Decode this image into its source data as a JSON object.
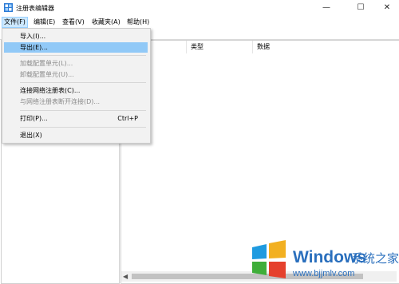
{
  "window": {
    "title": "注册表编辑器"
  },
  "menubar": {
    "items": [
      "文件(F)",
      "编辑(E)",
      "查看(V)",
      "收藏夹(A)",
      "帮助(H)"
    ]
  },
  "file_menu": {
    "items": [
      {
        "label": "导入(I)...",
        "disabled": false
      },
      {
        "label": "导出(E)...",
        "disabled": false,
        "highlighted": true
      },
      {
        "label": "加载配置单元(L)...",
        "disabled": true
      },
      {
        "label": "卸载配置单元(U)...",
        "disabled": true
      },
      {
        "label": "连接网络注册表(C)...",
        "disabled": false
      },
      {
        "label": "与网络注册表断开连接(D)...",
        "disabled": true
      },
      {
        "label": "打印(P)...",
        "disabled": false,
        "shortcut": "Ctrl+P"
      },
      {
        "label": "退出(X)",
        "disabled": false
      }
    ]
  },
  "list": {
    "columns": [
      "类型",
      "数据"
    ]
  },
  "colors": {
    "highlight": "#91c9f7",
    "menu_active": "#cce8ff"
  },
  "watermark": {
    "brand": "Windows",
    "subtitle": "系统之家",
    "url": "www.bjjmlv.com"
  }
}
